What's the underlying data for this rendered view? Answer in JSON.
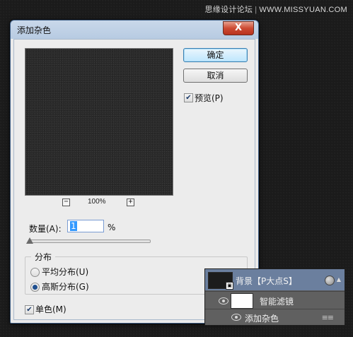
{
  "watermark": {
    "site_cn": "思缘设计论坛",
    "site_url": "WWW.MISSYUAN.COM"
  },
  "dialog": {
    "title": "添加杂色",
    "close_label": "X",
    "ok_label": "确定",
    "cancel_label": "取消",
    "preview": {
      "label": "预览(P)",
      "checked": true
    },
    "zoom": {
      "minus": "−",
      "level": "100%",
      "plus": "+"
    },
    "amount": {
      "label": "数量(A):",
      "value": "1",
      "unit": "%"
    },
    "distribution": {
      "title": "分布",
      "options": [
        {
          "label": "平均分布(U)",
          "selected": false
        },
        {
          "label": "高斯分布(G)",
          "selected": true
        }
      ]
    },
    "monochromatic": {
      "label": "单色(M)",
      "checked": true
    }
  },
  "layers": {
    "background_layer": {
      "name": "背景【P大点S】"
    },
    "smart_filters": {
      "name": "智能滤镜"
    },
    "filter_item": {
      "name": "添加杂色"
    }
  }
}
